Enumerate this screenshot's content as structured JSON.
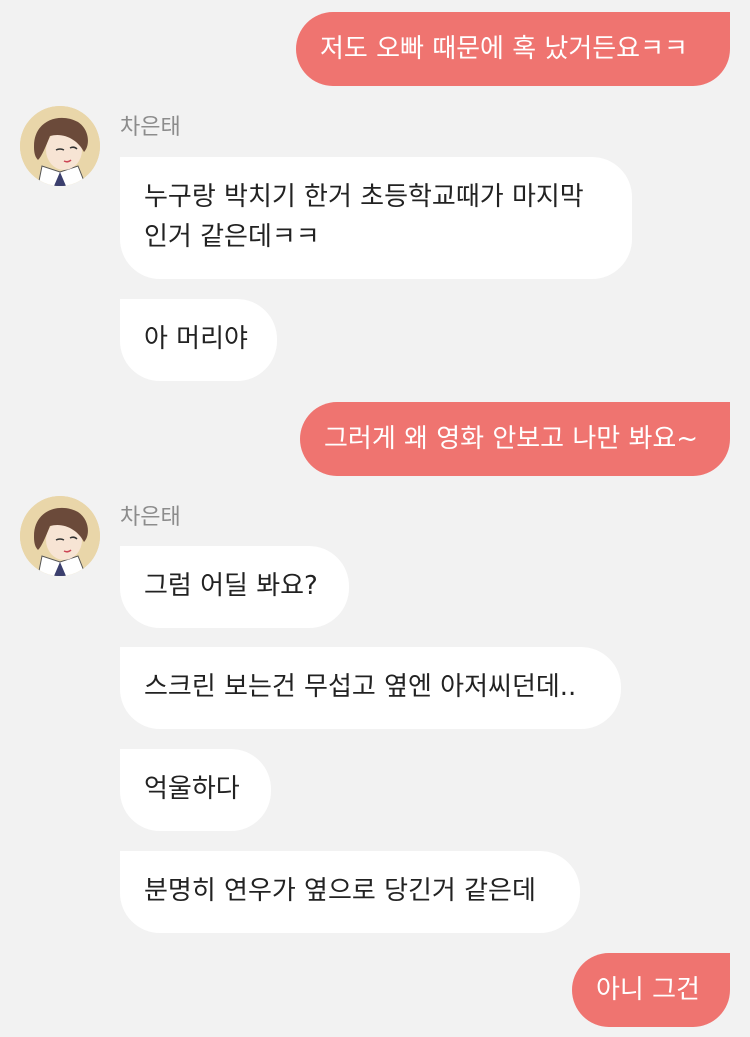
{
  "messages": {
    "m1": "저도 오빠 때문에 혹 났거든요ㅋㅋ",
    "m2_line1": "누구랑 박치기 한거 초등학교때가 마지막",
    "m2_line2": "인거 같은데ㅋㅋ",
    "m3": "아 머리야",
    "m4": "그러게 왜 영화 안보고 나만 봐요~",
    "m5": "그럼 어딜 봐요?",
    "m6": "스크린 보는건 무섭고 옆엔 아저씨던데..",
    "m7": "억울하다",
    "m8": "분명히 연우가 옆으로 당긴거 같은데",
    "m9": "아니 그건"
  },
  "contact": {
    "name": "차은태"
  },
  "colors": {
    "background": "#f2f2f2",
    "outgoing_bubble": "#ef7470",
    "incoming_bubble": "#ffffff",
    "sender_name": "#8c8c8c"
  },
  "icons": {
    "avatar": "avatar-illustration"
  }
}
